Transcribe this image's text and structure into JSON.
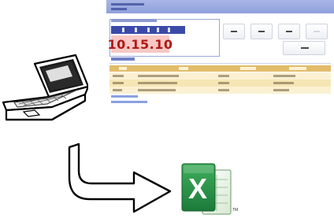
{
  "clock": {
    "time": "10.15.10"
  },
  "colors": {
    "title_bar": "#8fa0dc",
    "date_bar": "#3b4aa8",
    "clock_bg": "#f7c8c4",
    "clock_text": "#b01818",
    "grid_header": "#e1bc6a",
    "grid_row": "#fbf1d2",
    "excel_green": "#1d7a3a",
    "arrow_fill": "#ffffff",
    "arrow_stroke": "#000000"
  },
  "toolbar": {
    "button_count": 4
  },
  "grid": {
    "rows": 3
  },
  "excel": {
    "trademark": "TM"
  },
  "icons": {
    "laptop": "laptop-icon",
    "arrow": "curved-arrow-icon",
    "excel": "excel-icon"
  }
}
